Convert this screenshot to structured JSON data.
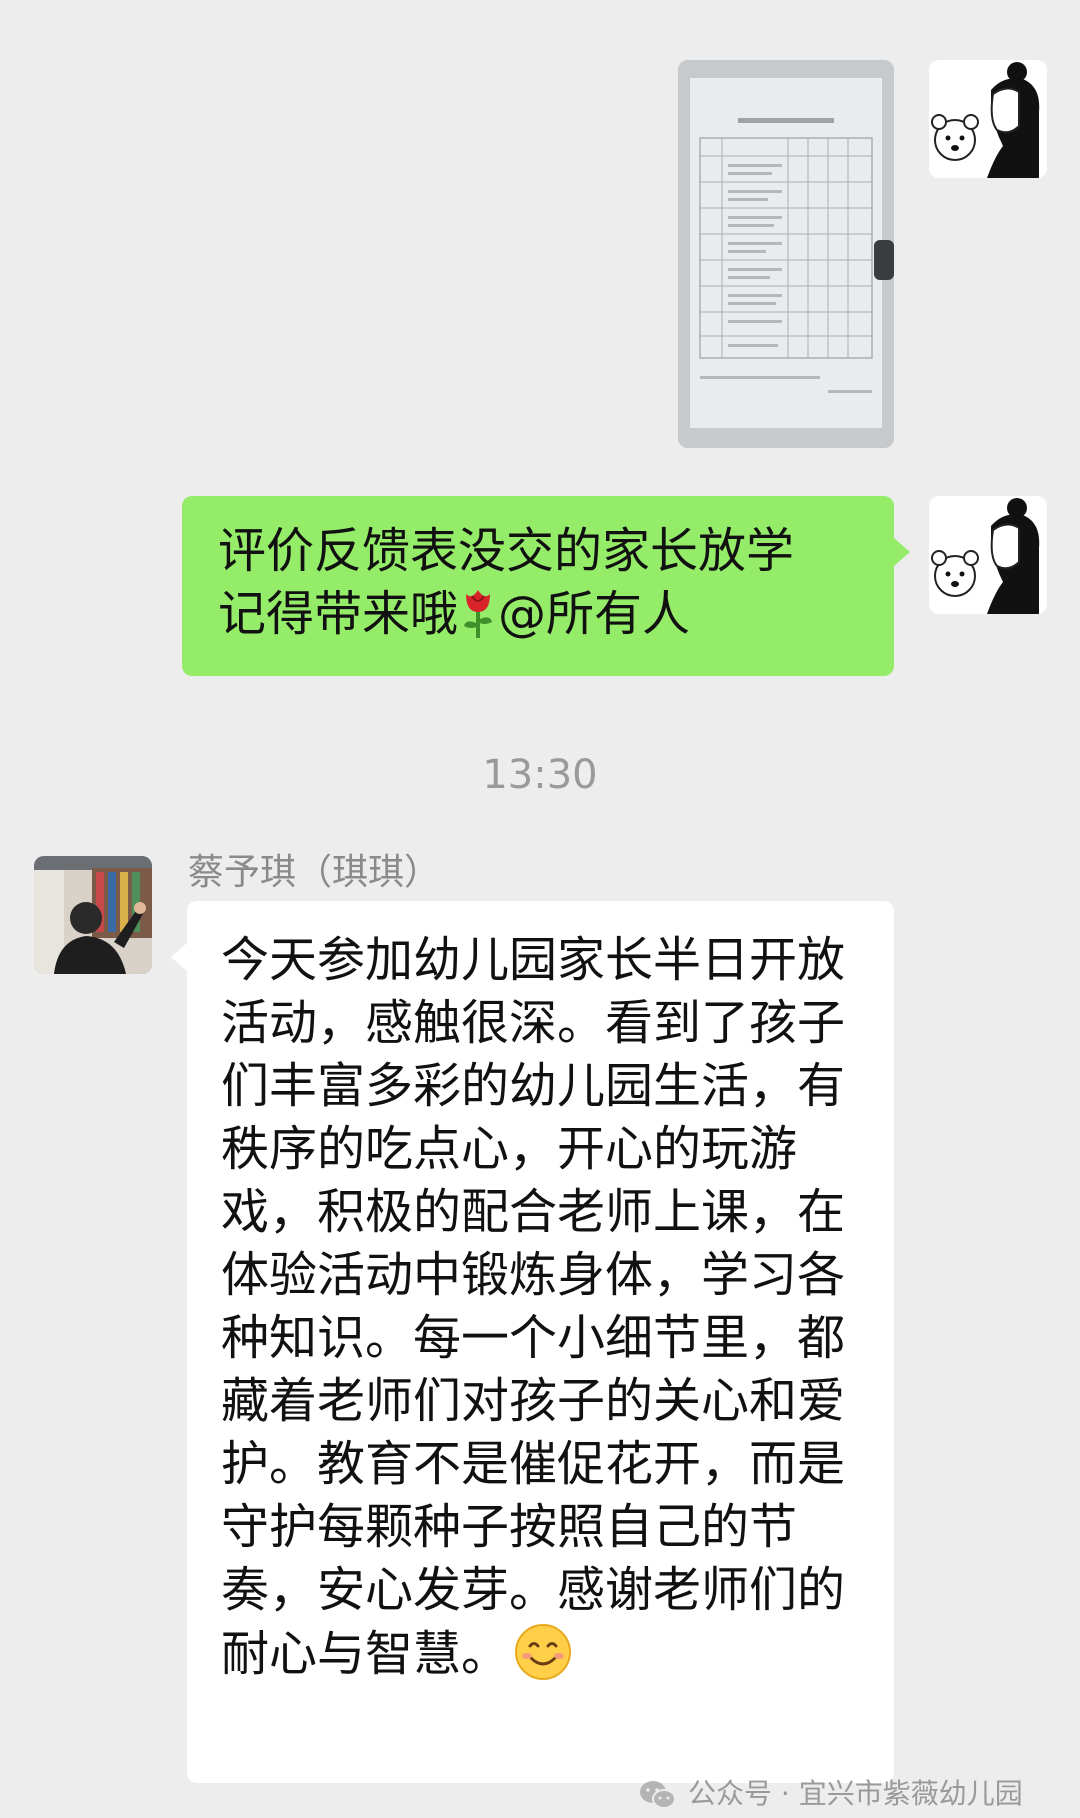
{
  "messages": {
    "outgoing_text": {
      "line1": "评价反馈表没交的家长放学",
      "line2_before_emoji": "记得带来哦",
      "emoji": "rose",
      "line2_after_emoji": "@所有人"
    },
    "timestamp": "13:30",
    "incoming": {
      "sender": "蔡予琪（琪琪）",
      "text": "今天参加幼儿园家长半日开放活动，感触很深。看到了孩子们丰富多彩的幼儿园生活，有秩序的吃点心，开心的玩游戏，积极的配合老师上课，在体验活动中锻炼身体，学习各种知识。每一个小细节里，都藏着老师们对孩子的关心和爱护。教育不是催促花开，而是守护每颗种子按照自己的节奏，安心发芽。感谢老师们的耐心与智慧。",
      "emoji": "smiling-face"
    }
  },
  "watermark": {
    "label": "公众号 · 宜兴市紫薇幼儿园",
    "icon": "wechat-icon"
  },
  "colors": {
    "background": "#ededed",
    "outgoing_bubble": "#95ec69",
    "incoming_bubble": "#ffffff",
    "meta_text": "#9a9a9a"
  }
}
